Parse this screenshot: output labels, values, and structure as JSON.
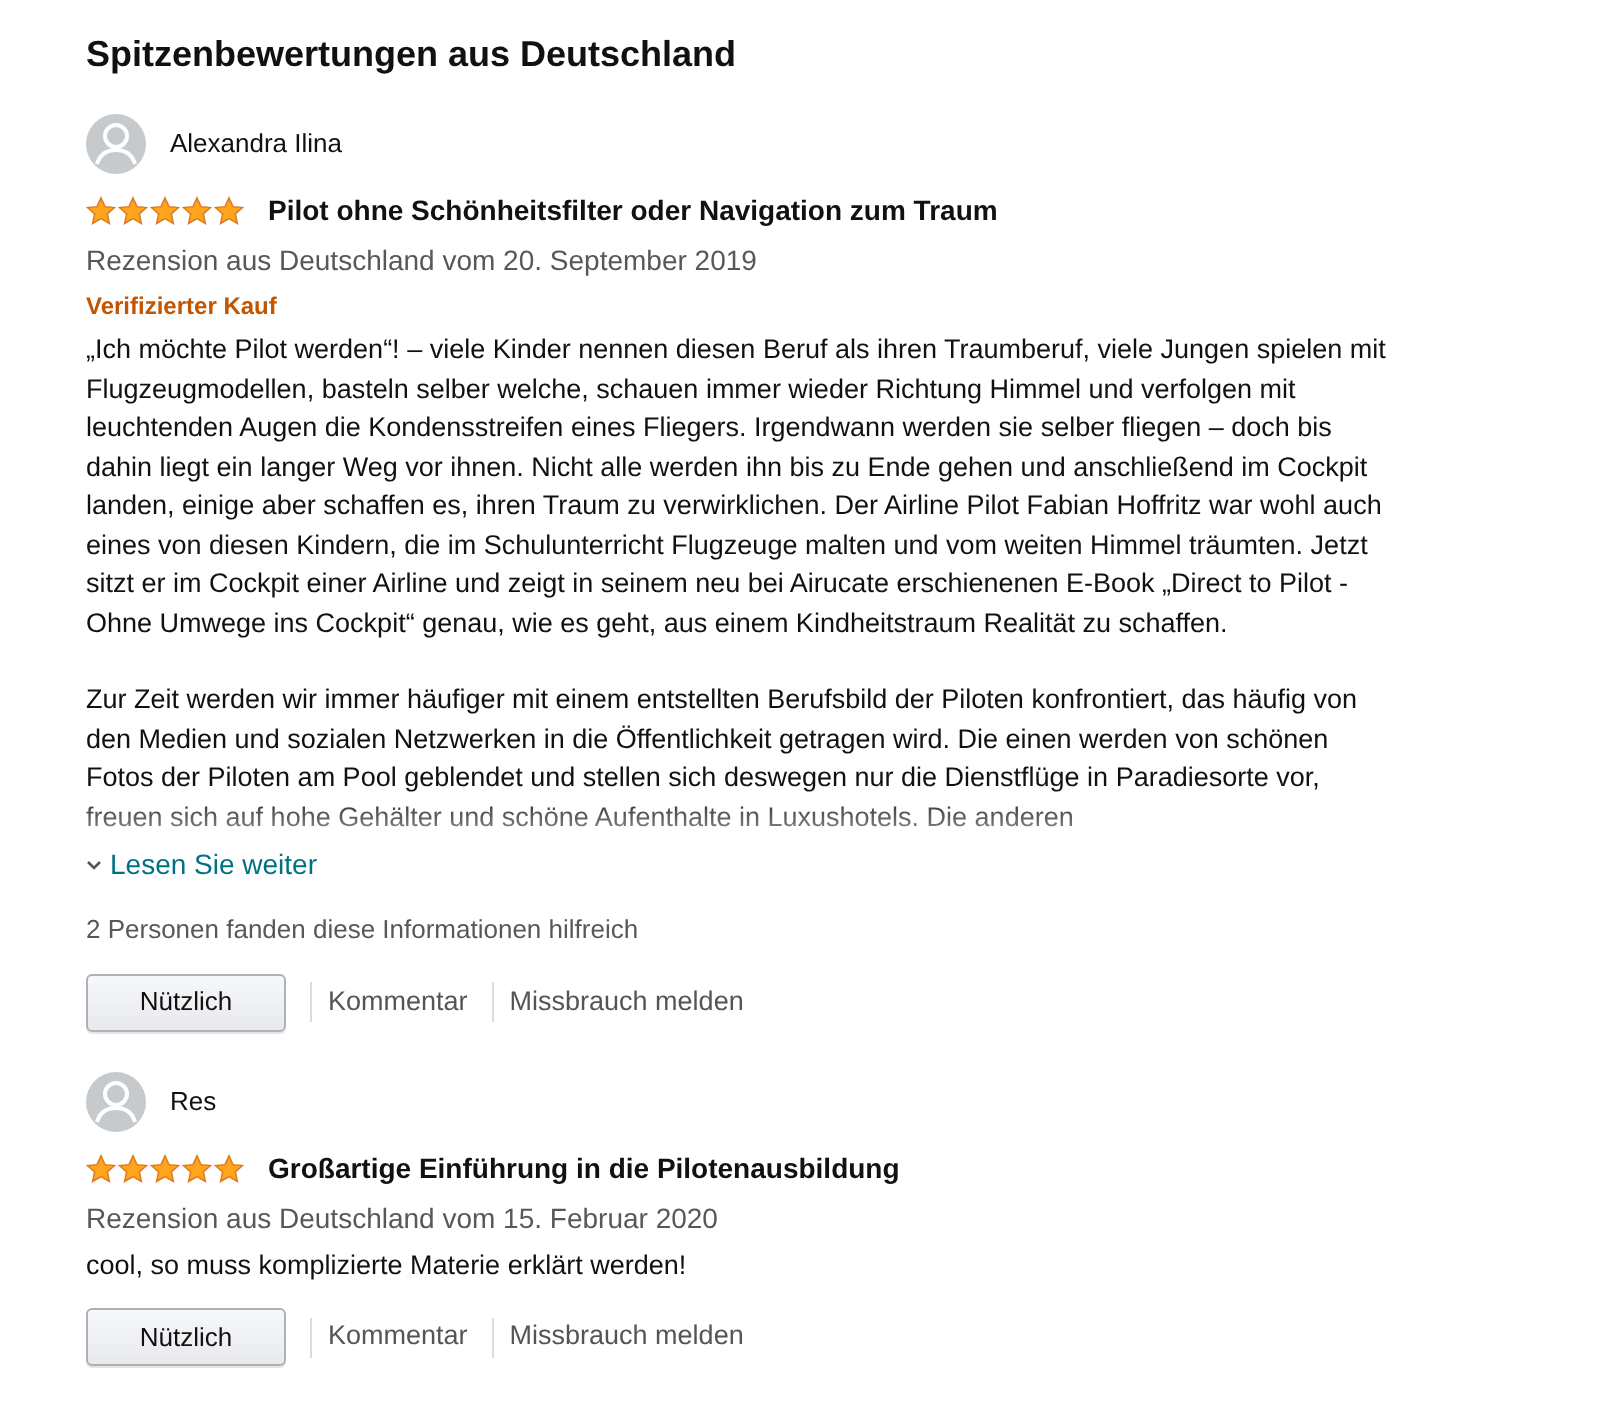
{
  "heading": "Spitzenbewertungen aus Deutschland",
  "reviews": [
    {
      "author": "Alexandra Ilina",
      "stars": 5,
      "title": "Pilot ohne Schönheitsfilter oder Navigation zum Traum",
      "date": "Rezension aus Deutschland vom 20. September 2019",
      "badge": "Verifizierter Kauf",
      "paragraphs": [
        "„Ich möchte Pilot werden“! – viele Kinder nennen diesen Beruf als ihren Traumberuf, viele Jungen spielen mit Flugzeugmodellen, basteln selber welche, schauen immer wieder Richtung Himmel und verfolgen mit leuchtenden Augen die Kondensstreifen eines Fliegers. Irgendwann werden sie selber fliegen – doch bis dahin liegt ein langer Weg vor ihnen. Nicht alle werden ihn bis zu Ende gehen und anschließend im Cockpit landen, einige aber schaffen es, ihren Traum zu verwirklichen. Der Airline Pilot Fabian Hoffritz war wohl auch eines von diesen Kindern, die im Schulunterricht Flugzeuge malten und vom weiten Himmel träumten. Jetzt sitzt er im Cockpit einer Airline und zeigt in seinem neu bei Airucate erschienenen E-Book „Direct to Pilot - Ohne Umwege ins Cockpit“ genau, wie es geht, aus einem Kindheitstraum Realität zu schaffen.",
        "Zur Zeit werden wir immer häufiger mit einem entstellten Berufsbild der Piloten konfrontiert, das häufig von den Medien und sozialen Netzwerken in die Öffentlichkeit getragen wird. Die einen werden von schönen Fotos der Piloten am Pool geblendet und stellen sich deswegen nur die Dienstflüge in Paradiesorte vor, freuen sich auf hohe Gehälter und schöne Aufenthalte in Luxushotels. Die anderen"
      ],
      "truncated": true,
      "read_more": "Lesen Sie weiter",
      "helpful": "2 Personen fanden diese Informationen hilfreich",
      "actions": [
        "Nützlich",
        "Kommentar",
        "Missbrauch melden"
      ]
    },
    {
      "author": "Res",
      "stars": 5,
      "title": "Großartige Einführung in die Pilotenausbildung",
      "date": "Rezension aus Deutschland vom 15. Februar 2020",
      "paragraphs": [
        "cool, so muss komplizierte Materie erklärt werden!"
      ],
      "truncated": false,
      "actions": [
        "Nützlich",
        "Kommentar",
        "Missbrauch melden"
      ]
    }
  ]
}
